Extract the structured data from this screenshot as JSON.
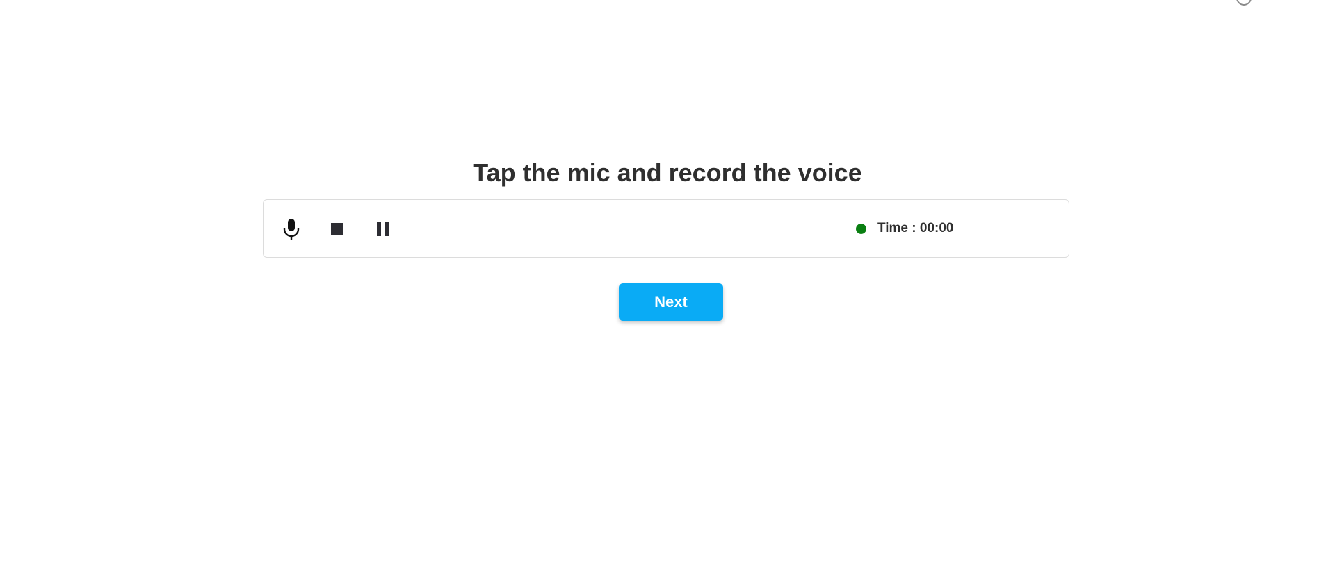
{
  "page": {
    "title": "Tap the mic and record the voice"
  },
  "recorder": {
    "controls": [
      {
        "name": "mic",
        "icon": "microphone-icon"
      },
      {
        "name": "stop",
        "icon": "stop-icon"
      },
      {
        "name": "pause",
        "icon": "pause-icon"
      }
    ],
    "status_color": "#0a7f12",
    "time_label": "Time",
    "time_separator": " : ",
    "time_value": "00:00"
  },
  "next_button": {
    "label": "Next",
    "color": "#0aabf5"
  },
  "loading_indicator": {
    "icon": "loading-spinner-icon"
  }
}
